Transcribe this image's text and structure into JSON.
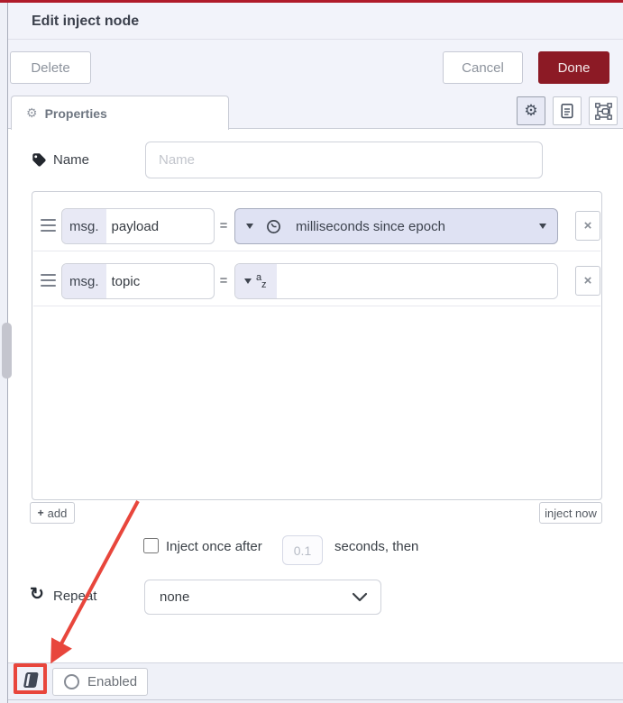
{
  "window": {
    "title": "Edit inject node"
  },
  "toolbar": {
    "delete": "Delete",
    "cancel": "Cancel",
    "done": "Done"
  },
  "tabbar": {
    "properties": "Properties"
  },
  "form": {
    "name": {
      "label": "Name",
      "placeholder": "Name"
    },
    "rules": [
      {
        "prefix": "msg.",
        "property": "payload",
        "eq": "=",
        "value": "milliseconds since epoch"
      },
      {
        "prefix": "msg.",
        "property": "topic",
        "eq": "=",
        "value": ""
      }
    ],
    "add": "add",
    "inject_now": "inject now",
    "once": {
      "before": "Inject once after",
      "seconds": "0.1",
      "after": "seconds, then",
      "checked": false
    },
    "repeat": {
      "label": "Repeat",
      "selected": "none"
    }
  },
  "footer": {
    "enabled": "Enabled"
  },
  "icons": {
    "gear": "⚙",
    "repeat": "↻",
    "close": "×",
    "plus": "+",
    "string_a": "a",
    "string_z": "z"
  },
  "colors": {
    "topbar_red": "#b01b2a",
    "done_red": "#8c1a25",
    "annotation_red": "#e8463c",
    "type_field_bg": "#dfe2f3",
    "prefix_bg": "#e8e9f5",
    "panel_bg": "#f2f3fa"
  }
}
